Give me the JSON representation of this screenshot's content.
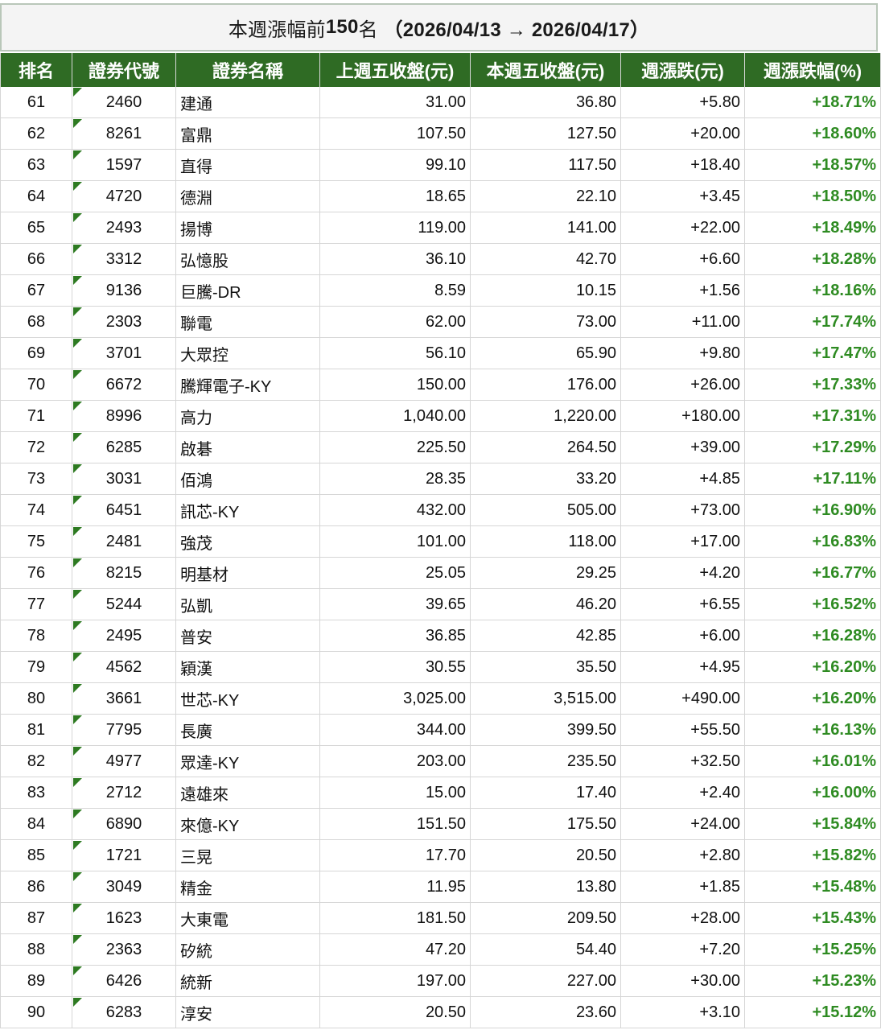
{
  "title": {
    "prefix": "本週漲幅前",
    "count": "150",
    "suffix": "名",
    "range": "（2026/04/13 → 2026/04/17）"
  },
  "headers": [
    "排名",
    "證券代號",
    "證券名稱",
    "上週五收盤(元)",
    "本週五收盤(元)",
    "週漲跌(元)",
    "週漲跌幅(%)"
  ],
  "accent_color": "#2f6b24",
  "pct_color": "#2e8b22",
  "rows": [
    [
      "61",
      "2460",
      "建通",
      "31.00",
      "36.80",
      "+5.80",
      "+18.71%"
    ],
    [
      "62",
      "8261",
      "富鼎",
      "107.50",
      "127.50",
      "+20.00",
      "+18.60%"
    ],
    [
      "63",
      "1597",
      "直得",
      "99.10",
      "117.50",
      "+18.40",
      "+18.57%"
    ],
    [
      "64",
      "4720",
      "德淵",
      "18.65",
      "22.10",
      "+3.45",
      "+18.50%"
    ],
    [
      "65",
      "2493",
      "揚博",
      "119.00",
      "141.00",
      "+22.00",
      "+18.49%"
    ],
    [
      "66",
      "3312",
      "弘憶股",
      "36.10",
      "42.70",
      "+6.60",
      "+18.28%"
    ],
    [
      "67",
      "9136",
      "巨騰-DR",
      "8.59",
      "10.15",
      "+1.56",
      "+18.16%"
    ],
    [
      "68",
      "2303",
      "聯電",
      "62.00",
      "73.00",
      "+11.00",
      "+17.74%"
    ],
    [
      "69",
      "3701",
      "大眾控",
      "56.10",
      "65.90",
      "+9.80",
      "+17.47%"
    ],
    [
      "70",
      "6672",
      "騰輝電子-KY",
      "150.00",
      "176.00",
      "+26.00",
      "+17.33%"
    ],
    [
      "71",
      "8996",
      "高力",
      "1,040.00",
      "1,220.00",
      "+180.00",
      "+17.31%"
    ],
    [
      "72",
      "6285",
      "啟碁",
      "225.50",
      "264.50",
      "+39.00",
      "+17.29%"
    ],
    [
      "73",
      "3031",
      "佰鴻",
      "28.35",
      "33.20",
      "+4.85",
      "+17.11%"
    ],
    [
      "74",
      "6451",
      "訊芯-KY",
      "432.00",
      "505.00",
      "+73.00",
      "+16.90%"
    ],
    [
      "75",
      "2481",
      "強茂",
      "101.00",
      "118.00",
      "+17.00",
      "+16.83%"
    ],
    [
      "76",
      "8215",
      "明基材",
      "25.05",
      "29.25",
      "+4.20",
      "+16.77%"
    ],
    [
      "77",
      "5244",
      "弘凱",
      "39.65",
      "46.20",
      "+6.55",
      "+16.52%"
    ],
    [
      "78",
      "2495",
      "普安",
      "36.85",
      "42.85",
      "+6.00",
      "+16.28%"
    ],
    [
      "79",
      "4562",
      "穎漢",
      "30.55",
      "35.50",
      "+4.95",
      "+16.20%"
    ],
    [
      "80",
      "3661",
      "世芯-KY",
      "3,025.00",
      "3,515.00",
      "+490.00",
      "+16.20%"
    ],
    [
      "81",
      "7795",
      "長廣",
      "344.00",
      "399.50",
      "+55.50",
      "+16.13%"
    ],
    [
      "82",
      "4977",
      "眾達-KY",
      "203.00",
      "235.50",
      "+32.50",
      "+16.01%"
    ],
    [
      "83",
      "2712",
      "遠雄來",
      "15.00",
      "17.40",
      "+2.40",
      "+16.00%"
    ],
    [
      "84",
      "6890",
      "來億-KY",
      "151.50",
      "175.50",
      "+24.00",
      "+15.84%"
    ],
    [
      "85",
      "1721",
      "三晃",
      "17.70",
      "20.50",
      "+2.80",
      "+15.82%"
    ],
    [
      "86",
      "3049",
      "精金",
      "11.95",
      "13.80",
      "+1.85",
      "+15.48%"
    ],
    [
      "87",
      "1623",
      "大東電",
      "181.50",
      "209.50",
      "+28.00",
      "+15.43%"
    ],
    [
      "88",
      "2363",
      "矽統",
      "47.20",
      "54.40",
      "+7.20",
      "+15.25%"
    ],
    [
      "89",
      "6426",
      "統新",
      "197.00",
      "227.00",
      "+30.00",
      "+15.23%"
    ],
    [
      "90",
      "6283",
      "淳安",
      "20.50",
      "23.60",
      "+3.10",
      "+15.12%"
    ]
  ]
}
